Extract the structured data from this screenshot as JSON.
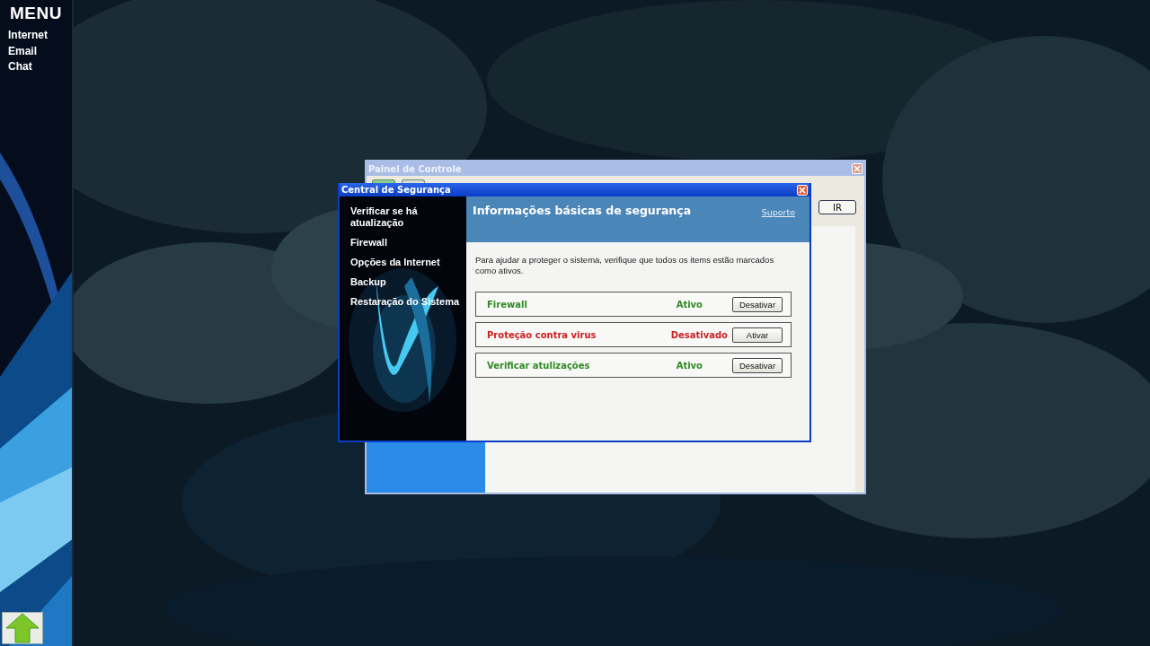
{
  "side_menu": {
    "title": "MENU",
    "items": [
      "Internet",
      "Email",
      "Chat"
    ]
  },
  "control_panel": {
    "title": "Painel de Controle",
    "go_button": "IR"
  },
  "security_center": {
    "title": "Central de Segurança",
    "sidebar": [
      "Verificar se há atualização",
      "Firewall",
      "Opções da Internet",
      "Backup",
      "Restaração do Sistema"
    ],
    "header": {
      "title": "Informações básicas de segurança",
      "link": "Suporte"
    },
    "intro": "Para ajudar a proteger o sistema, verifique que todos os items estão marcados como ativos.",
    "components": [
      {
        "name": "Firewall",
        "status": "Ativo",
        "active": true,
        "action": "Desativar"
      },
      {
        "name": "Proteção contra virus",
        "status": "Desativado",
        "active": false,
        "action": "Ativar"
      },
      {
        "name": "Verificar atulizações",
        "status": "Ativo",
        "active": true,
        "action": "Desativar"
      }
    ]
  }
}
